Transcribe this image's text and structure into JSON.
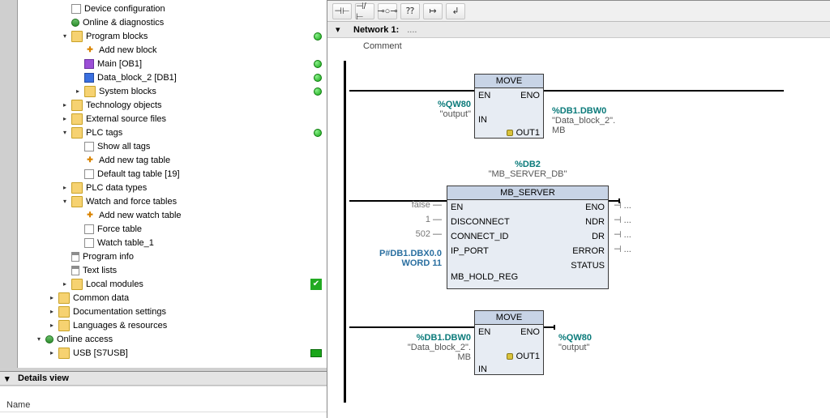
{
  "tree": {
    "items": [
      {
        "indent": 3,
        "exp": "none",
        "icon": "generic",
        "label": "Device configuration",
        "status": ""
      },
      {
        "indent": 3,
        "exp": "none",
        "icon": "online",
        "label": "Online & diagnostics",
        "status": ""
      },
      {
        "indent": 3,
        "exp": "open",
        "icon": "folder",
        "label": "Program blocks",
        "status": "dot"
      },
      {
        "indent": 4,
        "exp": "none",
        "icon": "add",
        "label": "Add new block",
        "status": ""
      },
      {
        "indent": 4,
        "exp": "none",
        "icon": "ob",
        "label": "Main [OB1]",
        "status": "dot"
      },
      {
        "indent": 4,
        "exp": "none",
        "icon": "db",
        "label": "Data_block_2 [DB1]",
        "status": "dot"
      },
      {
        "indent": 4,
        "exp": "closed",
        "icon": "folder",
        "label": "System blocks",
        "status": "dot"
      },
      {
        "indent": 3,
        "exp": "closed",
        "icon": "folder",
        "label": "Technology objects",
        "status": ""
      },
      {
        "indent": 3,
        "exp": "closed",
        "icon": "folder",
        "label": "External source files",
        "status": ""
      },
      {
        "indent": 3,
        "exp": "open",
        "icon": "folder",
        "label": "PLC tags",
        "status": "dot"
      },
      {
        "indent": 4,
        "exp": "none",
        "icon": "generic",
        "label": "Show all tags",
        "status": ""
      },
      {
        "indent": 4,
        "exp": "none",
        "icon": "add",
        "label": "Add new tag table",
        "status": ""
      },
      {
        "indent": 4,
        "exp": "none",
        "icon": "generic",
        "label": "Default tag table [19]",
        "status": ""
      },
      {
        "indent": 3,
        "exp": "closed",
        "icon": "folder",
        "label": "PLC data types",
        "status": ""
      },
      {
        "indent": 3,
        "exp": "open",
        "icon": "folder",
        "label": "Watch and force tables",
        "status": ""
      },
      {
        "indent": 4,
        "exp": "none",
        "icon": "add",
        "label": "Add new watch table",
        "status": ""
      },
      {
        "indent": 4,
        "exp": "none",
        "icon": "generic",
        "label": "Force table",
        "status": ""
      },
      {
        "indent": 4,
        "exp": "none",
        "icon": "generic",
        "label": "Watch table_1",
        "status": ""
      },
      {
        "indent": 3,
        "exp": "none",
        "icon": "doc",
        "label": "Program info",
        "status": ""
      },
      {
        "indent": 3,
        "exp": "none",
        "icon": "doc",
        "label": "Text lists",
        "status": ""
      },
      {
        "indent": 3,
        "exp": "closed",
        "icon": "folder",
        "label": "Local modules",
        "status": "check"
      },
      {
        "indent": 2,
        "exp": "closed",
        "icon": "folder",
        "label": "Common data",
        "status": ""
      },
      {
        "indent": 2,
        "exp": "closed",
        "icon": "folder",
        "label": "Documentation settings",
        "status": ""
      },
      {
        "indent": 2,
        "exp": "closed",
        "icon": "folder",
        "label": "Languages & resources",
        "status": ""
      },
      {
        "indent": 1,
        "exp": "open",
        "icon": "online",
        "label": "Online access",
        "status": ""
      },
      {
        "indent": 2,
        "exp": "closed",
        "icon": "folder",
        "label": "USB [S7USB]",
        "status": "usb"
      }
    ]
  },
  "details": {
    "header": "Details view",
    "column": "Name"
  },
  "toolbar": {
    "btns": [
      "⊣⊢",
      "⊣/⊢",
      "⊸○⊸",
      "⁇",
      "↦",
      "↲"
    ]
  },
  "network": {
    "title": "Network 1:",
    "extra": "....",
    "comment_label": "Comment"
  },
  "rung1": {
    "box_title": "MOVE",
    "en": "EN",
    "eno": "ENO",
    "in_label": "IN",
    "out_label": "OUT1",
    "in_addr": "%QW80",
    "in_sym": "\"output\"",
    "out_addr": "%DB1.DBW0",
    "out_sym": "\"Data_block_2\".",
    "out_sym2": "MB"
  },
  "rung2": {
    "inst_addr": "%DB2",
    "inst_sym": "\"MB_SERVER_DB\"",
    "box_title": "MB_SERVER",
    "en": "EN",
    "eno": "ENO",
    "left": [
      {
        "label": "DISCONNECT",
        "val": "false"
      },
      {
        "label": "CONNECT_ID",
        "val": "1"
      },
      {
        "label": "IP_PORT",
        "val": "502"
      },
      {
        "label": "MB_HOLD_REG",
        "val_top": "P#DB1.DBX0.0",
        "val_bot": "WORD 11"
      }
    ],
    "right": [
      {
        "label": "NDR",
        "dots": "..."
      },
      {
        "label": "DR",
        "dots": "..."
      },
      {
        "label": "ERROR",
        "dots": "..."
      },
      {
        "label": "STATUS",
        "dots": "..."
      }
    ]
  },
  "rung3": {
    "box_title": "MOVE",
    "en": "EN",
    "eno": "ENO",
    "in_label": "IN",
    "out_label": "OUT1",
    "in_addr": "%DB1.DBW0",
    "in_sym1": "\"Data_block_2\".",
    "in_sym2": "MB",
    "out_addr": "%QW80",
    "out_sym": "\"output\""
  }
}
